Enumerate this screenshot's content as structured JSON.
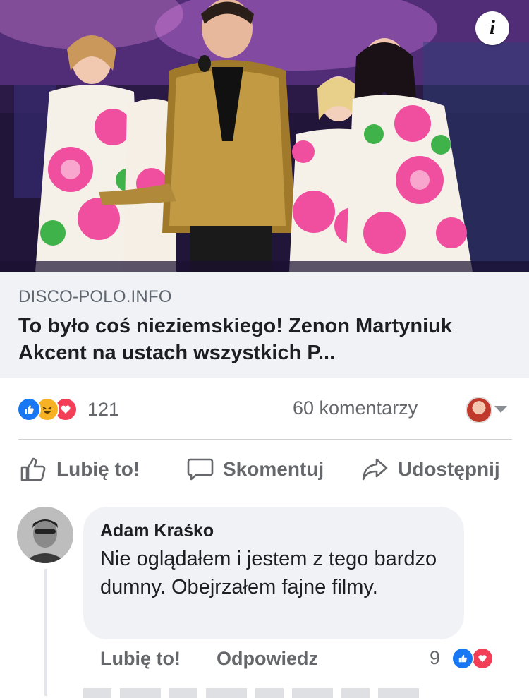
{
  "link_preview": {
    "image_alt": "Stage performance photo",
    "info_icon": "info-icon",
    "domain": "DISCO-POLO.INFO",
    "headline": "To było coś nieziemskiego! Zenon Martyniuk Akcent na ustach wszystkich P..."
  },
  "stats": {
    "reactions_count": "121",
    "reaction_icons": [
      "like-icon",
      "haha-icon",
      "love-icon"
    ],
    "comments_count": "60 komentarzy"
  },
  "actions": {
    "like_label": "Lubię to!",
    "comment_label": "Skomentuj",
    "share_label": "Udostępnij"
  },
  "comment": {
    "author": "Adam Kraśko",
    "text": "Nie oglądałem i jestem z tego bardzo dumny. Obejrzałem fajne filmy.",
    "like_label": "Lubię to!",
    "reply_label": "Odpowiedz",
    "reactions_count": "9"
  },
  "colors": {
    "like_blue": "#1877f2",
    "love_red": "#f33e58",
    "haha_yellow": "#f7b125",
    "muted_text": "#65676b",
    "card_bg": "#f0f2f5"
  }
}
